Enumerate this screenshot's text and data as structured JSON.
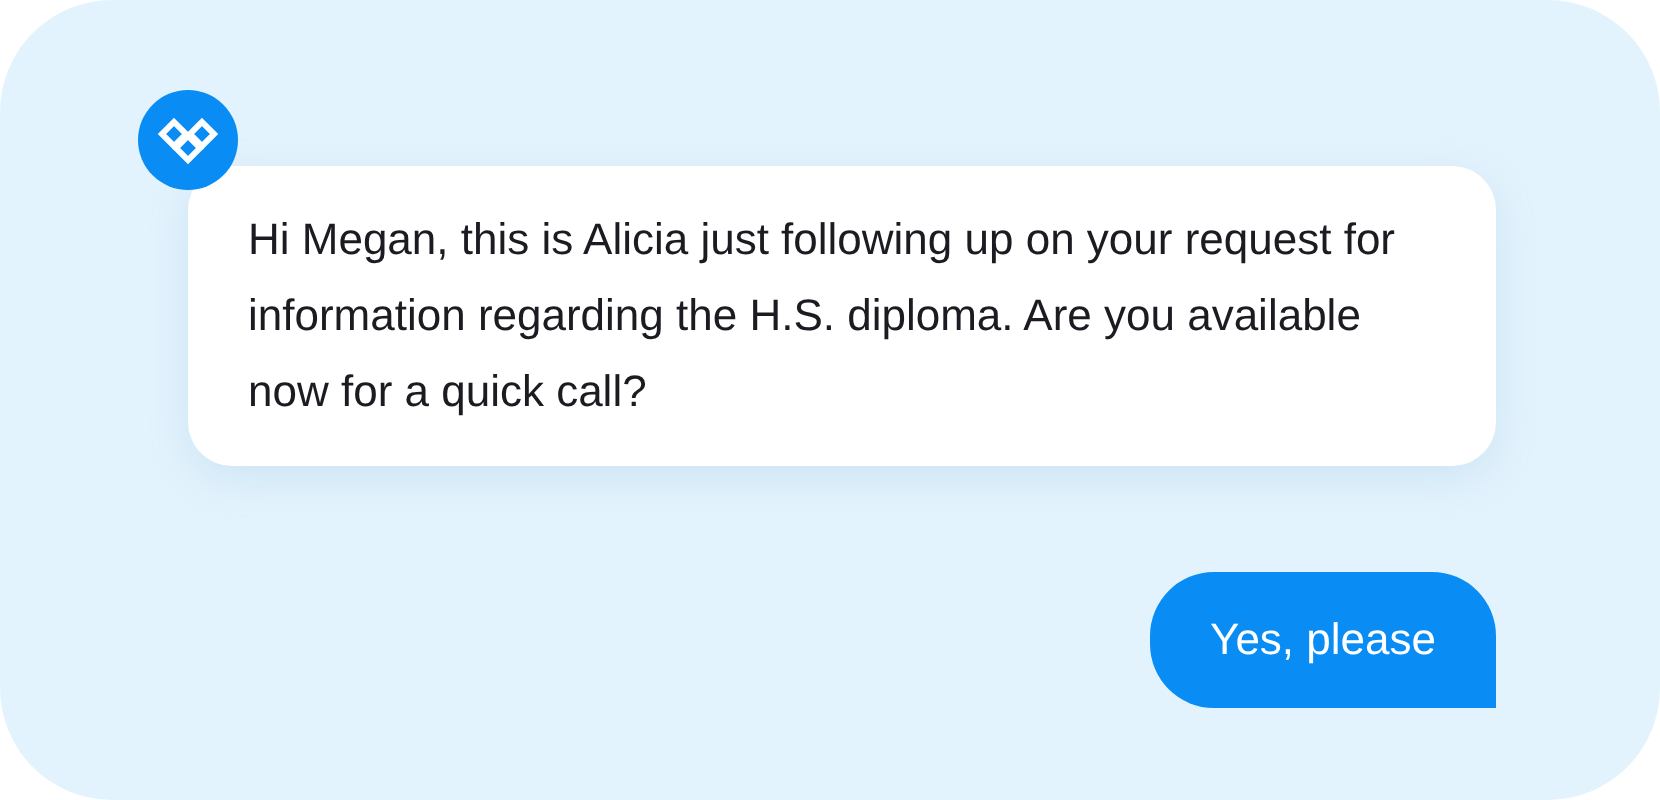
{
  "messages": [
    {
      "kind": "agent",
      "text": "Hi Megan, this is Alicia just following up on your request for information regarding the H.S. diploma. Are you available now for a quick call?"
    },
    {
      "kind": "user",
      "text": "Yes, please"
    }
  ]
}
